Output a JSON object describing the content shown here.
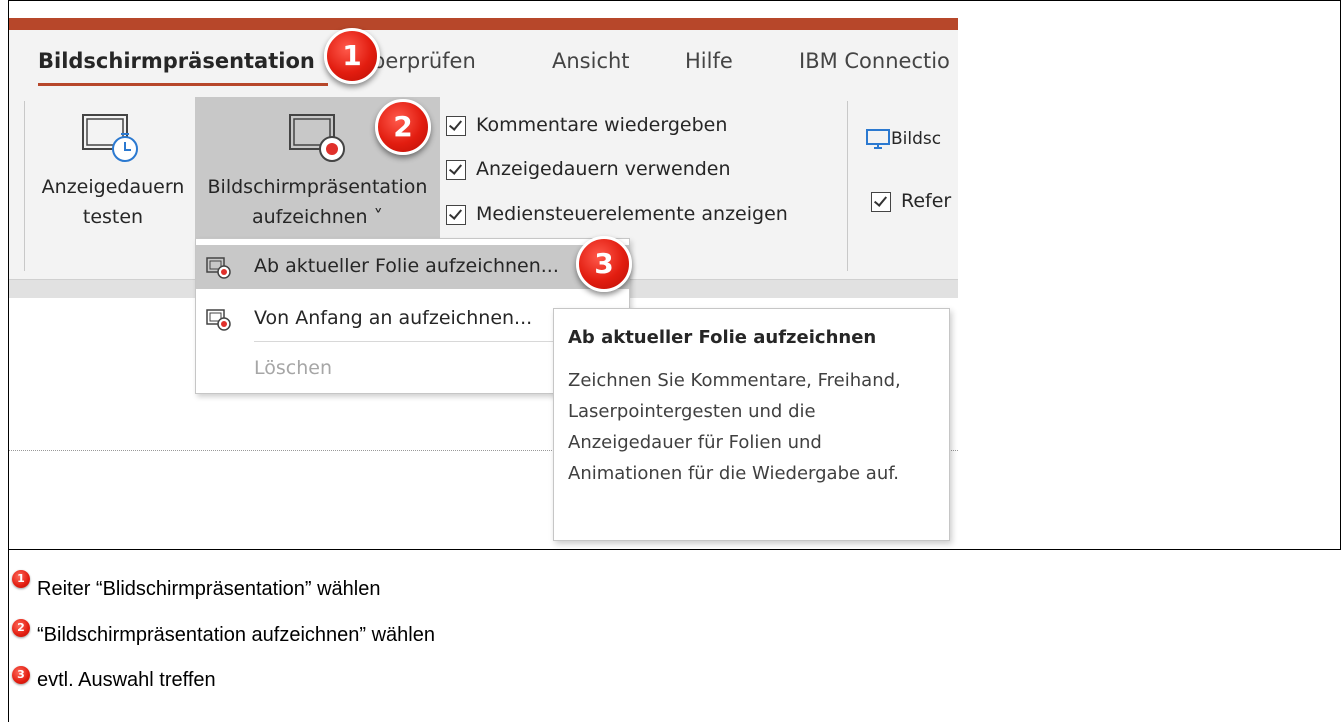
{
  "tabs": [
    {
      "label": "Bildschirmpräsentation",
      "active": true
    },
    {
      "label": "Überprüfen",
      "visible_part": "berprüfen"
    },
    {
      "label": "Ansicht"
    },
    {
      "label": "Hilfe"
    },
    {
      "label": "IBM Connectio"
    }
  ],
  "ribbon": {
    "rehearse_button": {
      "line1": "Anzeigedauern",
      "line2": "testen"
    },
    "record_button": {
      "line1": "Bildschirmpräsentation",
      "line2": "aufzeichnen ˅"
    },
    "checkboxes": [
      {
        "label": "Kommentare wiedergeben",
        "checked": true
      },
      {
        "label": "Anzeigedauern verwenden",
        "checked": true
      },
      {
        "label": "Mediensteuerelemente anzeigen",
        "checked": true
      }
    ],
    "monitor_label": "Bildsc",
    "presenter_checkbox": {
      "label": "Refer",
      "checked": true
    }
  },
  "dropdown_menu": {
    "items": [
      {
        "label": "Ab aktueller Folie aufzeichnen...",
        "highlighted": true
      },
      {
        "label": "Von Anfang an aufzeichnen...",
        "highlighted": false
      },
      {
        "label": "Löschen",
        "disabled": true
      }
    ]
  },
  "tooltip": {
    "title": "Ab aktueller Folie aufzeichnen",
    "body": "Zeichnen Sie Kommentare, Freihand, Laserpointergesten und die Anzeigedauer für Folien und Animationen für die Wiedergabe auf."
  },
  "callouts": [
    "1",
    "2",
    "3"
  ],
  "steps": [
    {
      "number": "1",
      "text": "Reiter “Blidschirmpräsentation” wählen"
    },
    {
      "number": "2",
      "text": "“Bildschirmpräsentation aufzeichnen” wählen"
    },
    {
      "number": "3",
      "text": "evtl. Auswahl treffen"
    }
  ],
  "colors": {
    "accent": "#b7472a",
    "record_red": "#e0302b",
    "badge_red": "#e21d10",
    "monitor_blue": "#2b79d0"
  }
}
